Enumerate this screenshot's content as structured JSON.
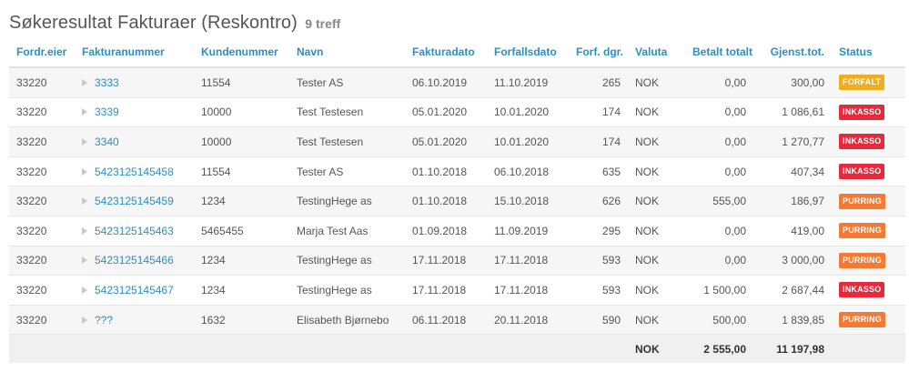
{
  "heading": {
    "title": "Søkeresultat Fakturaer (Reskontro)",
    "count": "9 treff"
  },
  "columns": {
    "owner": "Fordr.eier",
    "invoice": "Fakturanummer",
    "customer": "Kundenummer",
    "name": "Navn",
    "invoice_date": "Fakturadato",
    "due_date": "Forfallsdato",
    "overdue_days": "Forf. dgr.",
    "currency": "Valuta",
    "paid": "Betalt totalt",
    "remaining": "Gjenst.tot.",
    "status": "Status"
  },
  "status_colors": {
    "FORFALT": "#f0ad1e",
    "INKASSO": "#e6293b",
    "PURRING": "#f47a33"
  },
  "rows": [
    {
      "owner": "33220",
      "invoice": "3333",
      "customer": "11554",
      "name": "Tester AS",
      "invoice_date": "06.10.2019",
      "due_date": "11.10.2019",
      "overdue_days": "265",
      "currency": "NOK",
      "paid": "0,00",
      "remaining": "300,00",
      "status": "FORFALT"
    },
    {
      "owner": "33220",
      "invoice": "3339",
      "customer": "10000",
      "name": "Test Testesen",
      "invoice_date": "05.01.2020",
      "due_date": "10.01.2020",
      "overdue_days": "174",
      "currency": "NOK",
      "paid": "0,00",
      "remaining": "1 086,61",
      "status": "INKASSO"
    },
    {
      "owner": "33220",
      "invoice": "3340",
      "customer": "10000",
      "name": "Test Testesen",
      "invoice_date": "05.01.2020",
      "due_date": "10.01.2020",
      "overdue_days": "174",
      "currency": "NOK",
      "paid": "0,00",
      "remaining": "1 270,77",
      "status": "INKASSO"
    },
    {
      "owner": "33220",
      "invoice": "5423125145458",
      "customer": "11554",
      "name": "Tester AS",
      "invoice_date": "01.10.2018",
      "due_date": "06.10.2018",
      "overdue_days": "635",
      "currency": "NOK",
      "paid": "0,00",
      "remaining": "407,34",
      "status": "INKASSO"
    },
    {
      "owner": "33220",
      "invoice": "5423125145459",
      "customer": "1234",
      "name": "TestingHege as",
      "invoice_date": "01.10.2018",
      "due_date": "15.10.2018",
      "overdue_days": "626",
      "currency": "NOK",
      "paid": "555,00",
      "remaining": "186,97",
      "status": "PURRING"
    },
    {
      "owner": "33220",
      "invoice": "5423125145463",
      "customer": "5465455",
      "name": "Marja Test Aas",
      "invoice_date": "01.09.2018",
      "due_date": "11.09.2019",
      "overdue_days": "295",
      "currency": "NOK",
      "paid": "0,00",
      "remaining": "419,00",
      "status": "PURRING"
    },
    {
      "owner": "33220",
      "invoice": "5423125145466",
      "customer": "1234",
      "name": "TestingHege as",
      "invoice_date": "17.11.2018",
      "due_date": "17.11.2018",
      "overdue_days": "593",
      "currency": "NOK",
      "paid": "0,00",
      "remaining": "3 000,00",
      "status": "PURRING"
    },
    {
      "owner": "33220",
      "invoice": "5423125145467",
      "customer": "1234",
      "name": "TestingHege as",
      "invoice_date": "17.11.2018",
      "due_date": "17.11.2018",
      "overdue_days": "593",
      "currency": "NOK",
      "paid": "1 500,00",
      "remaining": "2 687,44",
      "status": "INKASSO"
    },
    {
      "owner": "33220",
      "invoice": "???",
      "customer": "1632",
      "name": "Elisabeth Bjørnebo",
      "invoice_date": "06.11.2018",
      "due_date": "20.11.2018",
      "overdue_days": "590",
      "currency": "NOK",
      "paid": "500,00",
      "remaining": "1 839,85",
      "status": "PURRING"
    }
  ],
  "totals": {
    "currency": "NOK",
    "paid": "2 555,00",
    "remaining": "11 197,98"
  }
}
